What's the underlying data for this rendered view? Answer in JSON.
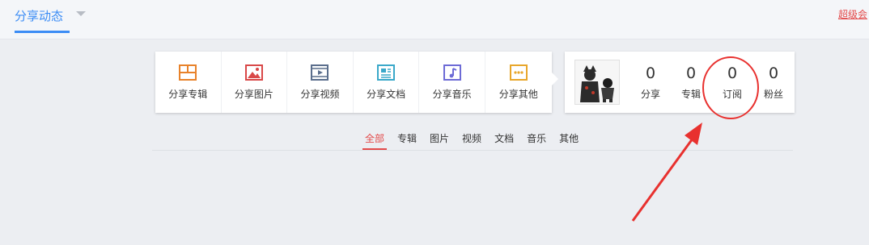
{
  "header": {
    "tab_label": "分享动态",
    "vip_link": "超级会"
  },
  "share_actions": [
    {
      "label": "分享专辑",
      "icon": "album-icon",
      "color": "#e8822a"
    },
    {
      "label": "分享图片",
      "icon": "picture-icon",
      "color": "#d94848"
    },
    {
      "label": "分享视频",
      "icon": "video-icon",
      "color": "#5a6e8c"
    },
    {
      "label": "分享文档",
      "icon": "document-icon",
      "color": "#3aa8c9"
    },
    {
      "label": "分享音乐",
      "icon": "music-icon",
      "color": "#6d6bd6"
    },
    {
      "label": "分享其他",
      "icon": "more-icon",
      "color": "#e8a62a"
    }
  ],
  "profile": {
    "stats": [
      {
        "value": "0",
        "label": "分享"
      },
      {
        "value": "0",
        "label": "专辑"
      },
      {
        "value": "0",
        "label": "订阅"
      },
      {
        "value": "0",
        "label": "粉丝"
      }
    ]
  },
  "filter_tabs": [
    "全部",
    "专辑",
    "图片",
    "视频",
    "文档",
    "音乐",
    "其他"
  ],
  "active_filter": "全部",
  "colors": {
    "accent_blue": "#3b8cf5",
    "accent_red": "#e34a4a",
    "annotation_red": "#e8312f"
  }
}
